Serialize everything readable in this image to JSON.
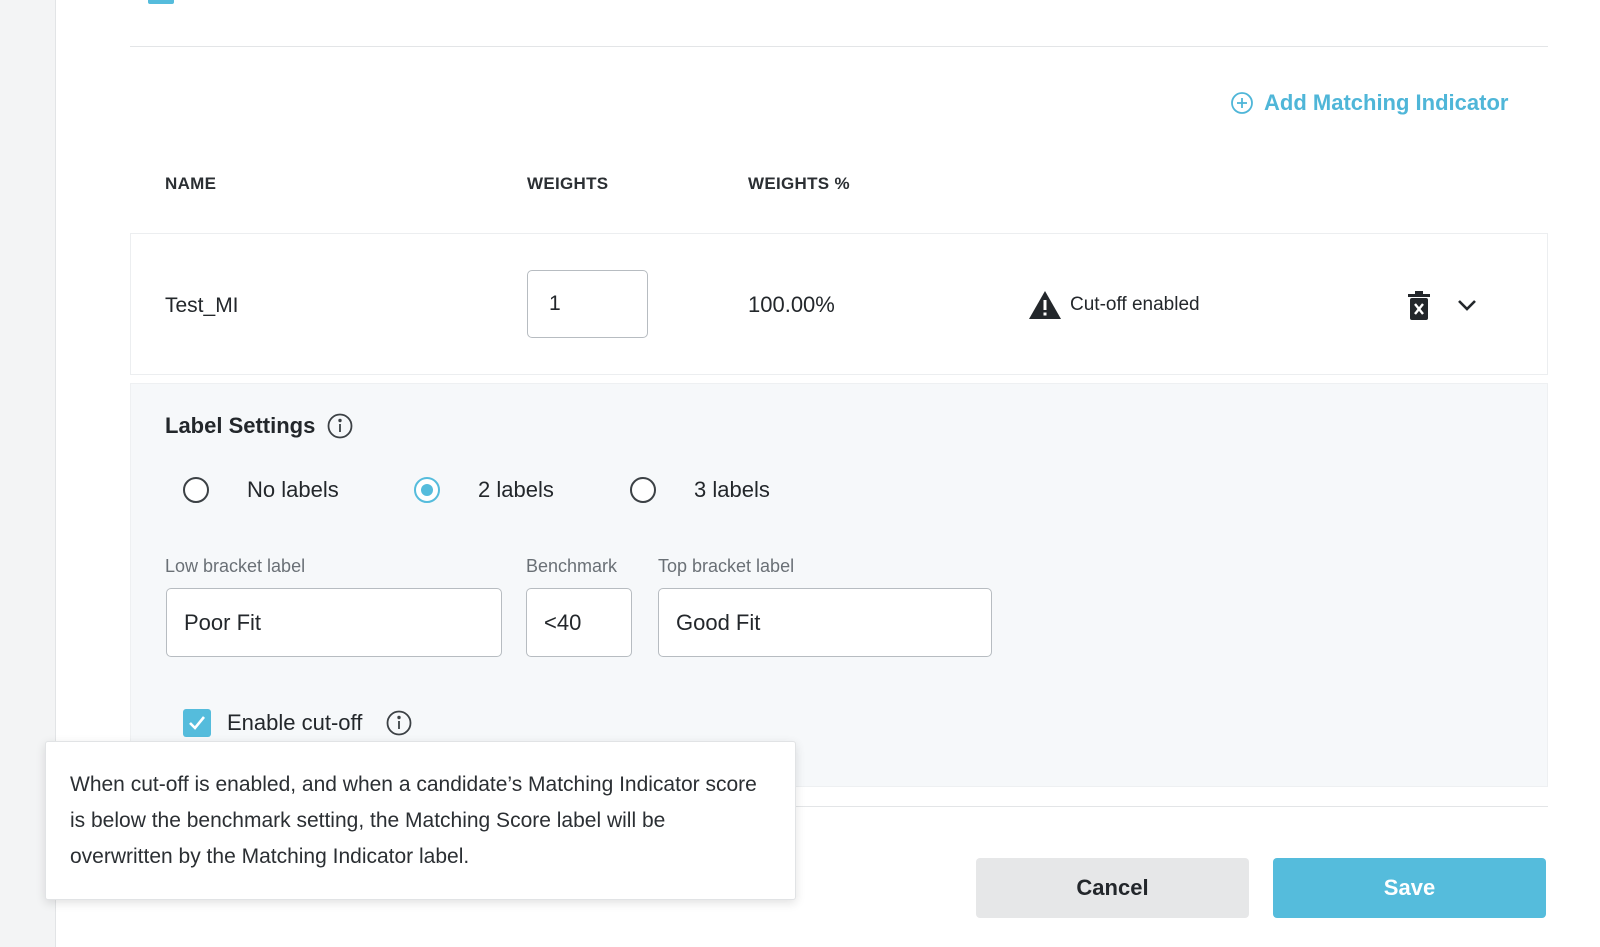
{
  "actions": {
    "add_matching_indicator": "Add Matching Indicator"
  },
  "table": {
    "headers": {
      "name": "NAME",
      "weights": "WEIGHTS",
      "weights_pct": "WEIGHTS %"
    },
    "row": {
      "name": "Test_MI",
      "weight": "1",
      "weight_pct": "100.00%",
      "status": "Cut-off enabled"
    }
  },
  "label_settings": {
    "title": "Label Settings",
    "options": [
      "No labels",
      "2 labels",
      "3 labels"
    ],
    "selected": "2 labels",
    "fields": {
      "low_label": "Low bracket label",
      "low_value": "Poor Fit",
      "benchmark_label": "Benchmark",
      "benchmark_value": "<40",
      "top_label": "Top bracket label",
      "top_value": "Good Fit"
    },
    "cutoff": {
      "label": "Enable cut-off",
      "checked": true
    }
  },
  "tooltip": {
    "text": "When cut-off is enabled, and when a candidate’s Matching Indicator score is below the benchmark setting, the Matching Score label will be overwritten by the Matching Indicator label."
  },
  "footer": {
    "cancel": "Cancel",
    "save": "Save"
  },
  "icons": {
    "add": "plus-circle-icon",
    "info": "info-icon",
    "warning": "warning-triangle-icon",
    "delete": "trash-icon",
    "expand": "chevron-down-icon",
    "check": "checkmark-icon"
  },
  "colors": {
    "accent": "#55bcdc",
    "link": "#4fb6d8",
    "panel_bg": "#f6f8fa",
    "cancel_bg": "#e6e7e8"
  }
}
